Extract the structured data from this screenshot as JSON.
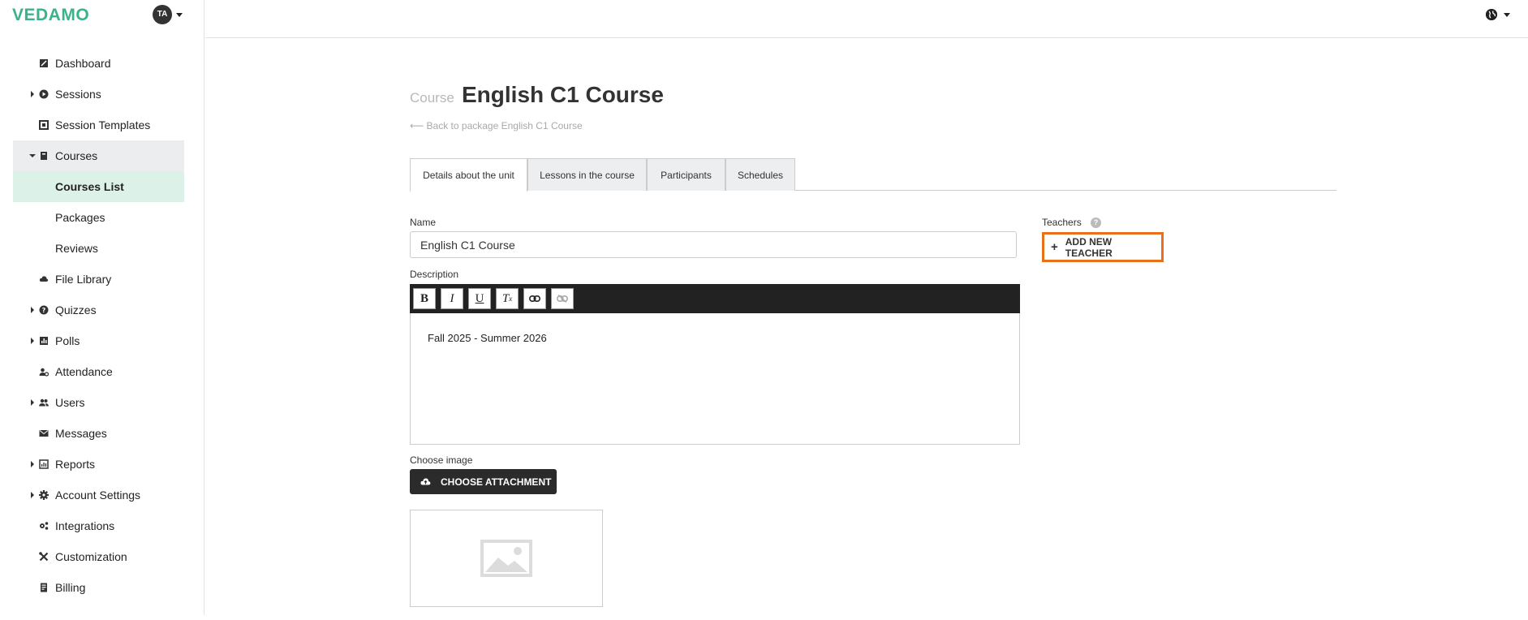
{
  "brand": {
    "logo": "VEDAMO",
    "avatar_initials": "TA",
    "logo_color": "#3bb38a"
  },
  "sidebar": {
    "items": [
      {
        "label": "Dashboard",
        "icon": "dashboard-icon"
      },
      {
        "label": "Sessions",
        "icon": "play-circle-icon",
        "expandable": true
      },
      {
        "label": "Session Templates",
        "icon": "template-icon"
      },
      {
        "label": "Courses",
        "icon": "book-icon",
        "expandable": true,
        "open": true
      },
      {
        "label": "Courses List",
        "active": true
      },
      {
        "label": "Packages"
      },
      {
        "label": "Reviews"
      },
      {
        "label": "File Library",
        "icon": "cloud-icon"
      },
      {
        "label": "Quizzes",
        "icon": "question-icon",
        "expandable": true
      },
      {
        "label": "Polls",
        "icon": "poll-icon",
        "expandable": true
      },
      {
        "label": "Attendance",
        "icon": "attendance-icon"
      },
      {
        "label": "Users",
        "icon": "users-icon",
        "expandable": true
      },
      {
        "label": "Messages",
        "icon": "envelope-icon"
      },
      {
        "label": "Reports",
        "icon": "report-icon",
        "expandable": true
      },
      {
        "label": "Account Settings",
        "icon": "gear-icon",
        "expandable": true
      },
      {
        "label": "Integrations",
        "icon": "integrations-icon"
      },
      {
        "label": "Customization",
        "icon": "tools-icon"
      },
      {
        "label": "Billing",
        "icon": "billing-icon"
      }
    ]
  },
  "page": {
    "kicker": "Course",
    "title": "English C1 Course",
    "back_link": "⟵ Back to package English C1 Course"
  },
  "tabs": [
    {
      "label": "Details about the unit",
      "active": true
    },
    {
      "label": "Lessons in the course"
    },
    {
      "label": "Participants"
    },
    {
      "label": "Schedules"
    }
  ],
  "form": {
    "name_label": "Name",
    "name_value": "English C1 Course",
    "description_label": "Description",
    "description_text": "Fall 2025 - Summer 2026",
    "choose_image_label": "Choose image",
    "attach_button": "CHOOSE ATTACHMENT"
  },
  "teachers": {
    "label": "Teachers",
    "help": "?",
    "add_button": "ADD NEW TEACHER",
    "highlight_color": "#e8701a"
  },
  "editor_toolbar": [
    "B",
    "I",
    "U",
    "Tx",
    "link",
    "unlink"
  ]
}
